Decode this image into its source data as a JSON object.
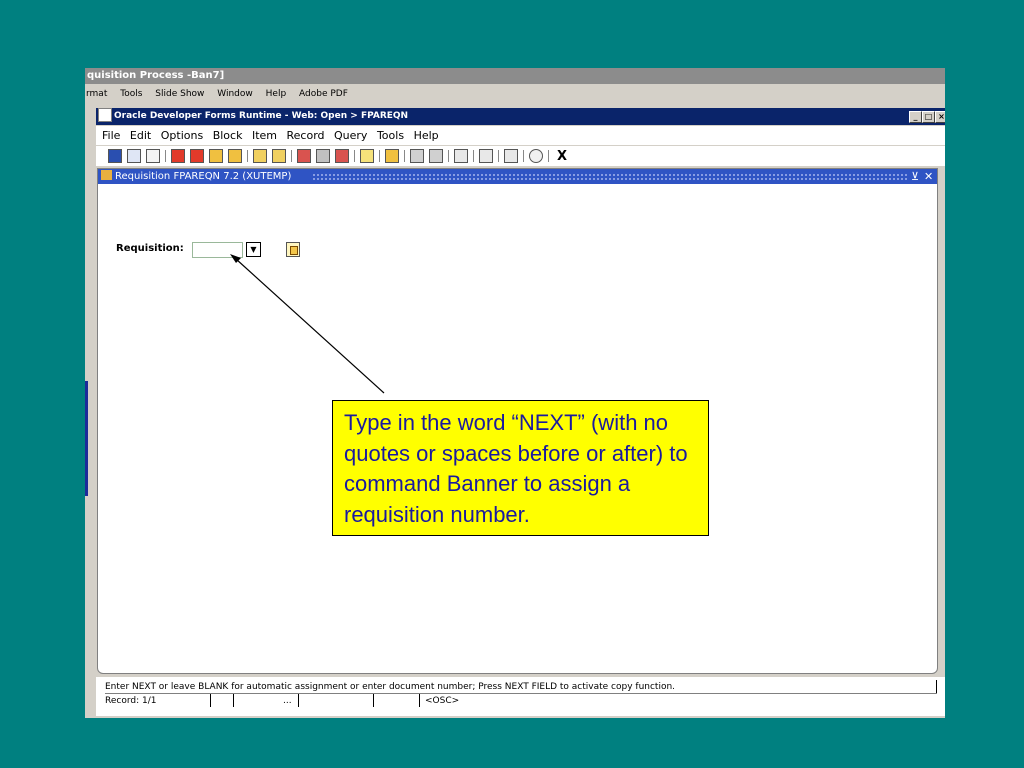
{
  "powerpoint": {
    "title": "quisition Process -Ban7]",
    "menu": [
      "rmat",
      "Tools",
      "Slide Show",
      "Window",
      "Help",
      "Adobe PDF"
    ]
  },
  "oracle": {
    "title": "Oracle Developer Forms Runtime - Web:  Open > FPAREQN",
    "menu": [
      "File",
      "Edit",
      "Options",
      "Block",
      "Item",
      "Record",
      "Query",
      "Tools",
      "Help"
    ],
    "toolbar_close": "X"
  },
  "form": {
    "title": "Requisition  FPAREQN  7.2  (XUTEMP)",
    "requisition_label": "Requisition:",
    "requisition_value": ""
  },
  "callout": {
    "text": "Type in the word “NEXT” (with no quotes or spaces before or after) to command Banner to assign a requisition number."
  },
  "status": {
    "message": "Enter NEXT or leave BLANK for automatic assignment or enter document number; Press NEXT FIELD to activate copy function.",
    "record": "Record: 1/1",
    "ellipsis": "...",
    "osc": "<OSC>"
  },
  "colors": {
    "background": "#008080",
    "callout_fill": "#ffff00",
    "callout_text": "#1a1aa0",
    "oracle_title_bar": "#0a246a",
    "form_title_bar": "#2f54c4"
  }
}
